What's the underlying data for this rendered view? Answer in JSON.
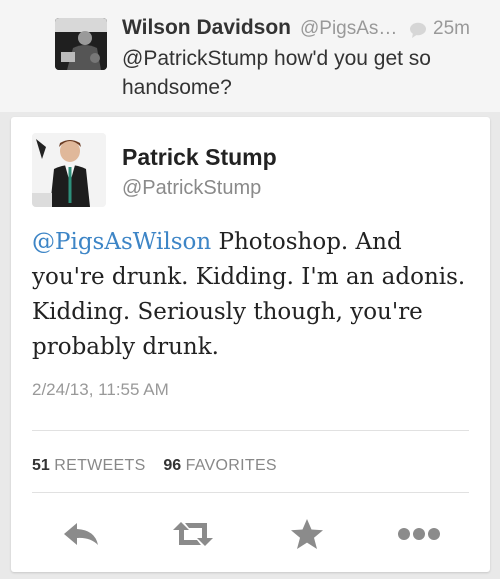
{
  "reply_tweet": {
    "author_name": "Wilson Davidson",
    "handle": "@PigsAs…",
    "time": "25m",
    "text": "@PatrickStump how'd you get so handsome?"
  },
  "main_tweet": {
    "author_name": "Patrick Stump",
    "handle": "@PatrickStump",
    "mention": "@PigsAsWilson",
    "text": " Photoshop. And you're drunk. Kidding. I'm an adonis. Kidding. Seriously though, you're probably drunk.",
    "timestamp": "2/24/13, 11:55 AM",
    "retweet_count": "51",
    "retweet_label": "RETWEETS",
    "favorite_count": "96",
    "favorite_label": "FAVORITES"
  },
  "actions": {
    "icons": [
      "reply-icon",
      "retweet-icon",
      "favorite-star-icon",
      "more-dots-icon"
    ]
  },
  "colors": {
    "mention_blue": "#3d85c6",
    "icon_gray": "#8b8b8b",
    "background": "#e9e9e9"
  }
}
